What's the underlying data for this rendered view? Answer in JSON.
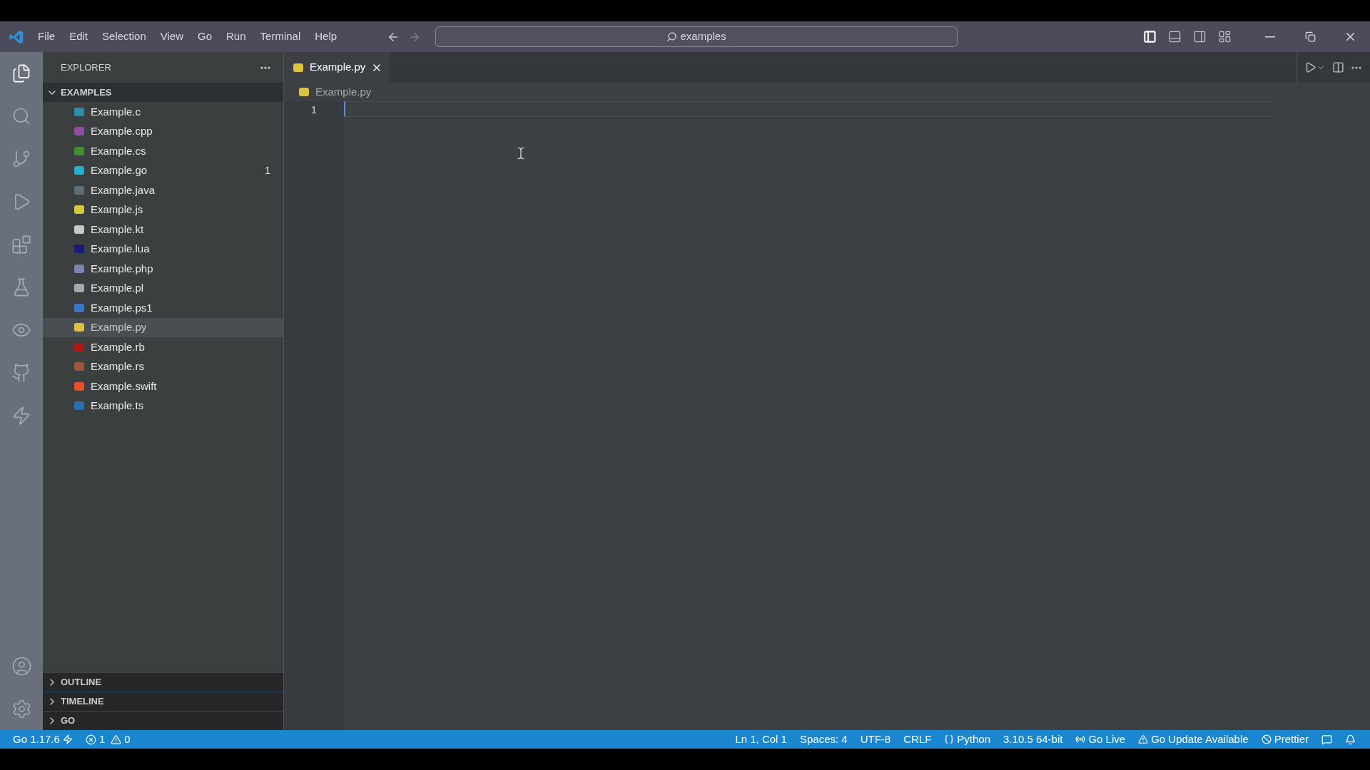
{
  "title_bar": {
    "menu": [
      "File",
      "Edit",
      "Selection",
      "View",
      "Go",
      "Run",
      "Terminal",
      "Help"
    ],
    "nav": [
      {
        "kind": "back",
        "disabled": false
      },
      {
        "kind": "forward",
        "disabled": true
      }
    ],
    "search": {
      "value": "examples"
    },
    "layout_buttons": [
      {
        "kind": "sidebar",
        "on": true
      },
      {
        "kind": "panel",
        "on": false
      },
      {
        "kind": "secondary",
        "on": false
      },
      {
        "kind": "customize",
        "on": false
      }
    ]
  },
  "activity_bar": [
    {
      "kind": "explorer",
      "selected": true
    },
    {
      "kind": "search",
      "selected": false
    },
    {
      "kind": "source-control",
      "selected": false
    },
    {
      "kind": "run",
      "selected": false
    },
    {
      "kind": "extensions",
      "selected": false
    },
    {
      "kind": "testing",
      "selected": false
    },
    {
      "kind": "remote",
      "selected": false
    },
    {
      "kind": "github",
      "selected": false
    },
    {
      "kind": "lightning",
      "selected": false
    }
  ],
  "activity_bottom": [
    {
      "kind": "account"
    },
    {
      "kind": "settings"
    }
  ],
  "sidebar": {
    "title": "EXPLORER",
    "folder": {
      "name": "EXAMPLES",
      "expanded": true,
      "files": [
        {
          "name": "Example.c",
          "color": "#2f8fa8",
          "selected": false
        },
        {
          "name": "Example.cpp",
          "color": "#8e4ea0",
          "selected": false
        },
        {
          "name": "Example.cs",
          "color": "#3f8f2f",
          "selected": false
        },
        {
          "name": "Example.go",
          "color": "#27b0c8",
          "selected": false,
          "badge": "1"
        },
        {
          "name": "Example.java",
          "color": "#5a6f7a",
          "selected": false
        },
        {
          "name": "Example.js",
          "color": "#d6c93c",
          "selected": false
        },
        {
          "name": "Example.kt",
          "color": "#c8c8c8",
          "selected": false
        },
        {
          "name": "Example.lua",
          "color": "#1a1a7a",
          "selected": false
        },
        {
          "name": "Example.php",
          "color": "#7a86b0",
          "selected": false
        },
        {
          "name": "Example.pl",
          "color": "#a0a8b0",
          "selected": false
        },
        {
          "name": "Example.ps1",
          "color": "#3a78c8",
          "selected": false
        },
        {
          "name": "Example.py",
          "color": "#e0c040",
          "selected": true
        },
        {
          "name": "Example.rb",
          "color": "#b01818",
          "selected": false
        },
        {
          "name": "Example.rs",
          "color": "#9a5a3a",
          "selected": false
        },
        {
          "name": "Example.swift",
          "color": "#e8502a",
          "selected": false
        },
        {
          "name": "Example.ts",
          "color": "#2d6fa8",
          "selected": false
        }
      ]
    },
    "sections": [
      {
        "name": "OUTLINE",
        "expanded": false
      },
      {
        "name": "TIMELINE",
        "expanded": false
      },
      {
        "name": "GO",
        "expanded": false
      }
    ]
  },
  "tabs": [
    {
      "label": "Example.py",
      "selected": true
    }
  ],
  "breadcrumb": "Example.py",
  "editor": {
    "line_numbers": [
      "1"
    ]
  },
  "status_bar": {
    "left": [
      {
        "kind": "go-version",
        "text": "Go 1.17.6"
      },
      {
        "kind": "problems",
        "errors": "1",
        "warnings": "0"
      }
    ],
    "right": [
      {
        "kind": "text",
        "text": "Ln 1, Col 1"
      },
      {
        "kind": "text",
        "text": "Spaces: 4"
      },
      {
        "kind": "text",
        "text": "UTF-8"
      },
      {
        "kind": "text",
        "text": "CRLF"
      },
      {
        "kind": "language",
        "text": "Python"
      },
      {
        "kind": "text",
        "text": "3.10.5 64-bit"
      },
      {
        "kind": "live",
        "text": "Go Live"
      },
      {
        "kind": "warning",
        "text": "Go Update Available"
      },
      {
        "kind": "prettier",
        "text": "Prettier"
      },
      {
        "kind": "feedback"
      },
      {
        "kind": "bell"
      }
    ]
  }
}
